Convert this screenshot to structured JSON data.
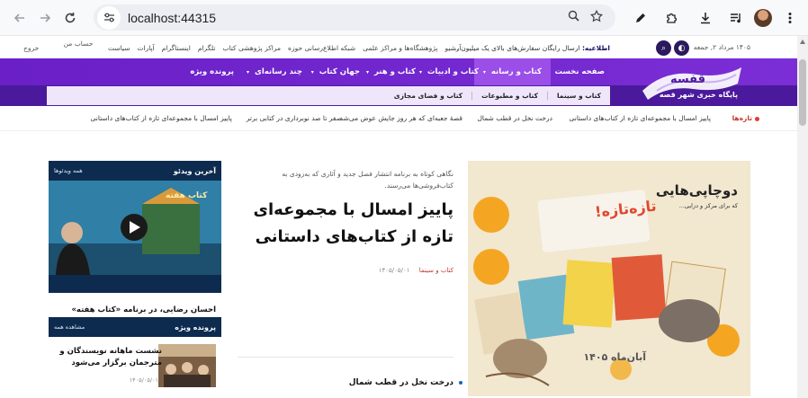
{
  "browser": {
    "url": "localhost:44315",
    "icons": [
      "back-arrow-icon",
      "forward-arrow-icon",
      "reload-icon",
      "site-settings-icon",
      "zoom-icon",
      "bookmark-star-icon",
      "pen-icon",
      "extensions-icon",
      "download-icon",
      "media-queue-icon",
      "avatar",
      "more-menu-icon"
    ]
  },
  "topbar": {
    "date": "۱۴۰۵ مرداد ۲, جمعه",
    "notice_label": "اطلاعیه:",
    "notice_text": "ارسال رایگان سفارش‌های بالای یک میلیون ...",
    "links": [
      "آرشیو",
      "پژوهشگاه‌ها و مراکز علمی",
      "شبکه اطلاع‌رسانی حوزه",
      "مراکز پژوهشی کتاب",
      "تلگرام",
      "اینستاگرام",
      "آپارات",
      "سیاست"
    ],
    "account": "حساب من",
    "logout": "خروج"
  },
  "logo": {
    "name": "قفسه",
    "tagline": "پایگاه خبری شهر قصه"
  },
  "nav": {
    "items": [
      {
        "label": "صفحه نخست",
        "dropdown": false
      },
      {
        "label": "کتاب و رسانه",
        "dropdown": true,
        "active": true
      },
      {
        "label": "کتاب و ادبیات",
        "dropdown": true
      },
      {
        "label": "کتاب و هنر",
        "dropdown": true
      },
      {
        "label": "جهان کتاب",
        "dropdown": true
      },
      {
        "label": "چند رسانه‌ای",
        "dropdown": true
      },
      {
        "label": "پرونده ویژه",
        "dropdown": false
      }
    ],
    "dropdown_icon": "▾",
    "subitems": [
      "کتاب و سینما",
      "کتاب و مطبوعات",
      "کتاب و فضای مجازی"
    ]
  },
  "ticker": {
    "label": "تازه‌ها",
    "items": [
      "پاییز امسال با مجموعه‌ای تازه از کتاب‌های داستانی",
      "درخت نخل در قطب شمال",
      "قصهٔ جعبه‌ای که هر روز جایش عوض می‌شد",
      "صفر تا صد نوبرداری در کتابی برتر",
      "پاییز امسال با مجموعه‌ای تازه از کتاب‌های داستانی"
    ]
  },
  "hero": {
    "badge": "دوچاپی‌هایی",
    "sub": "که برای مرکز و دزایی...",
    "note": "تازه‌تازه!",
    "footer": "آبان‌ماه ۱۴۰۵"
  },
  "main": {
    "lead": "نگاهی کوتاه به برنامه انتشار فصل جدید و آثاری که به‌زودی به کتاب‌فروشی‌ها می‌رسند.",
    "title": "پاییز امسال با مجموعه‌ای تازه از کتاب‌های داستانی",
    "category": "کتاب و سینما",
    "date": "۱۴۰۵/۰۵/۰۱",
    "next_item": "درخت نخل در قطب شمال"
  },
  "video": {
    "heading": "آخرین ویدئو",
    "all": "همه ویدئوها",
    "caption": "احسان رضایی، در برنامه «کتاب هفته»",
    "overlay": "کتاب هفته"
  },
  "project": {
    "heading": "پرونده ویژه",
    "all": "مشاهده همه",
    "item_title": "نشست ماهانه نویسندگان و مترجمان برگزار می‌شود",
    "item_date": "۱۴۰۵/۰۵/۰۱"
  },
  "colors": {
    "nav_purple": "#6a1fc7",
    "nav_active": "#9c4ee8",
    "sub_bg": "#efe6fb",
    "accent_red": "#c0392b",
    "panel_navy": "#0d2b4f"
  }
}
